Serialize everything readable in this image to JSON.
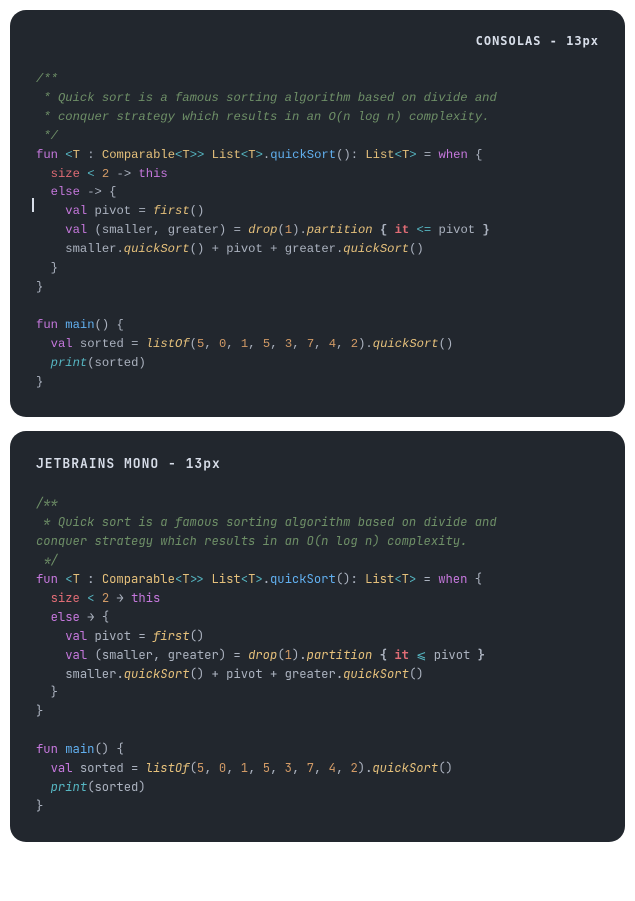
{
  "card1": {
    "title": "CONSOLAS - 13px",
    "comment1": "/**",
    "comment2": " * Quick sort is a famous sorting algorithm based on divide and",
    "comment3": " * conquer strategy which results in an O(n log n) complexity.",
    "comment4": " */",
    "kw_fun": "fun",
    "lt": "<",
    "T": "T",
    "colon_sp": " : ",
    "Comparable": "Comparable",
    "gt": ">",
    "List": "List",
    "dot": ".",
    "quickSort": "quickSort",
    "parens": "()",
    "colon": ": ",
    "eq": " = ",
    "when": "when",
    "space_brace": " {",
    "size": "size",
    "lt_op": " < ",
    "two": "2",
    "arrow": " -> ",
    "this": "this",
    "else": "else",
    "val": "val",
    "pivot": "pivot",
    "eq2": " = ",
    "first": "first",
    "parens2": "()",
    "lparen": "(",
    "smaller": "smaller",
    "comma": ", ",
    "greater": "greater",
    "rparen": ")",
    "drop": "drop",
    "one": "1",
    "partition": "partition",
    "it": "it",
    "lte": " <= ",
    "plus": " + ",
    "plus2": " + ",
    "main": "main",
    "sorted": "sorted",
    "listOf": "listOf",
    "n5": "5",
    "n0": "0",
    "n1": "1",
    "n5b": "5",
    "n3": "3",
    "n7": "7",
    "n4": "4",
    "n2": "2",
    "print": "print",
    "close_brace": "}",
    "open_brace": "{",
    "ind2": "  ",
    "ind4": "    ",
    "gtgt": ">>"
  },
  "card2": {
    "title": "JETBRAINS MONO - 13px",
    "comment1": "/**",
    "comment2": " * Quick sort is a famous sorting algorithm based on divide and",
    "comment3": "conquer strategy which results in an O(n log n) complexity.",
    "comment4": " */",
    "arrow_lig": " → ",
    "lte_lig": " ⩽ "
  }
}
